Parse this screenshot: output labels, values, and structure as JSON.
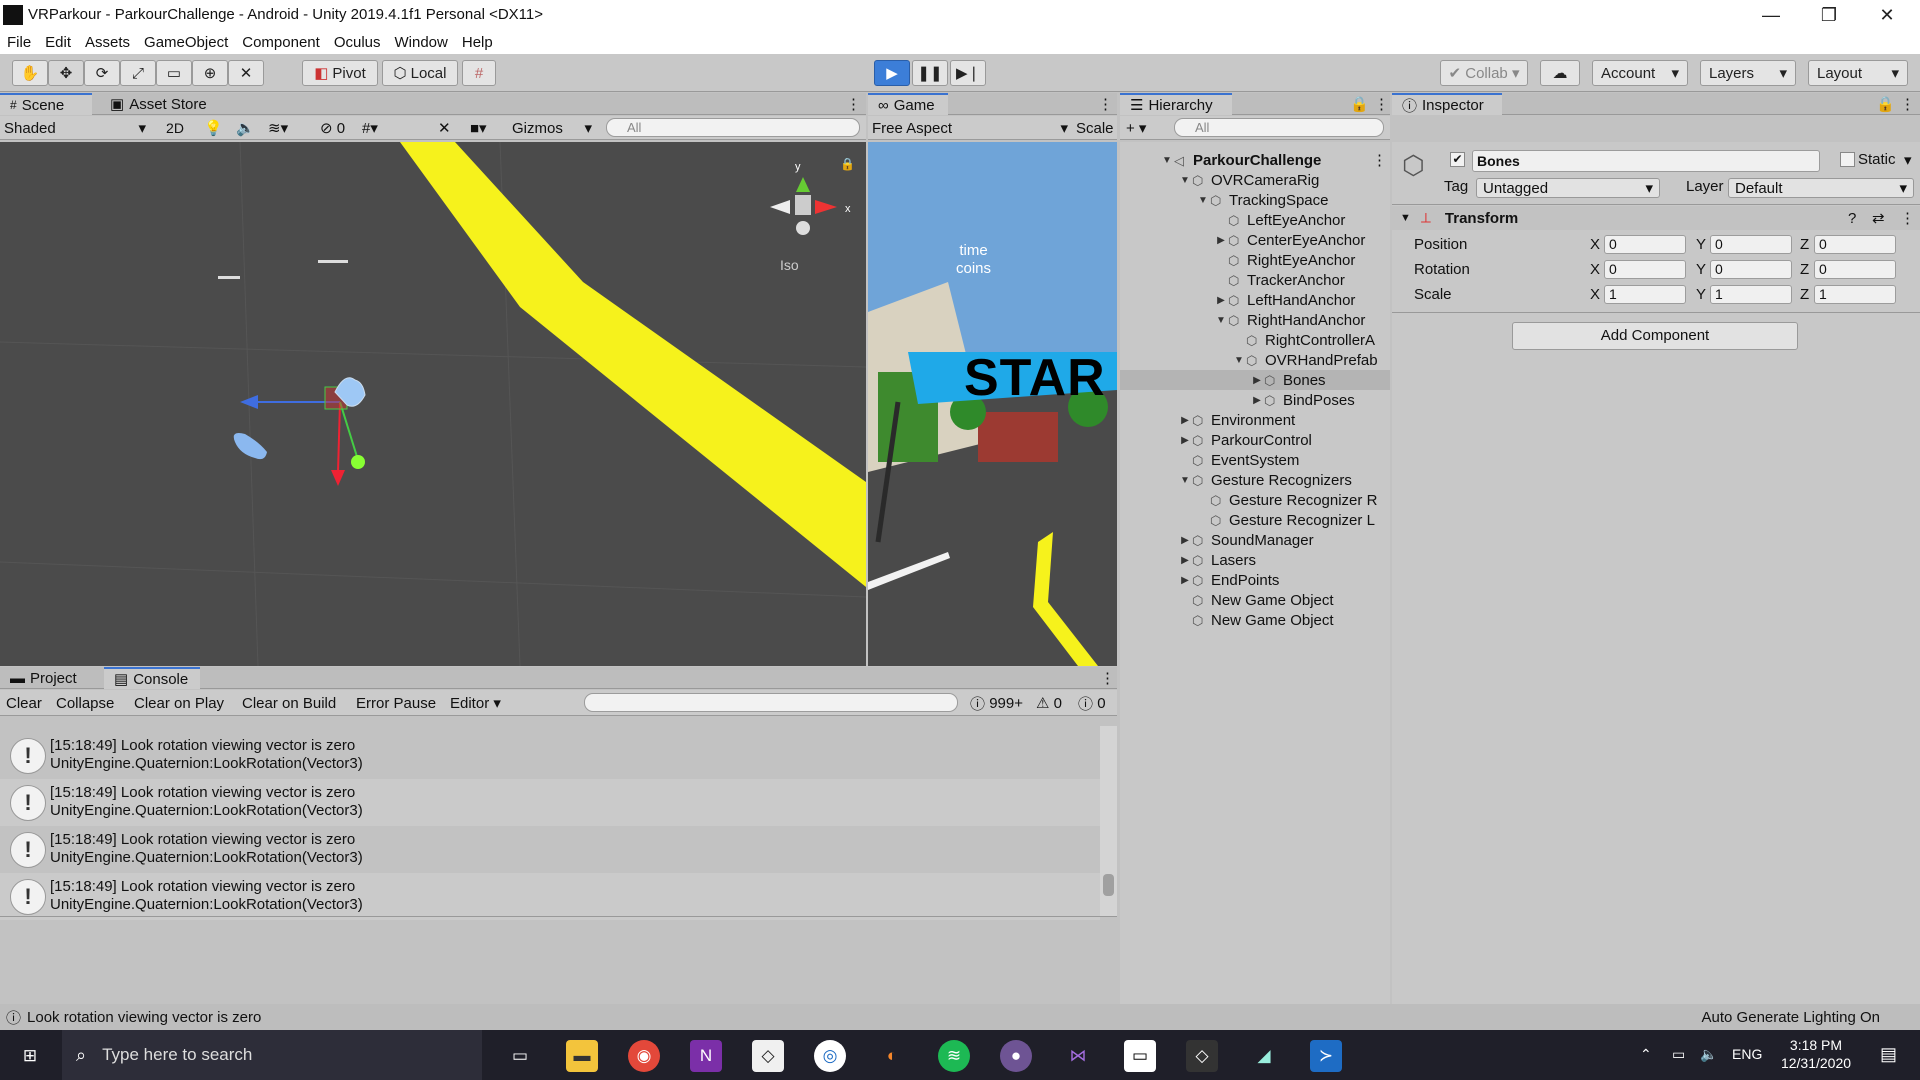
{
  "window": {
    "title": "VRParkour - ParkourChallenge - Android - Unity 2019.4.1f1 Personal <DX11>",
    "minimize": "—",
    "restore": "❐",
    "close": "✕"
  },
  "menu": [
    "File",
    "Edit",
    "Assets",
    "GameObject",
    "Component",
    "Oculus",
    "Window",
    "Help"
  ],
  "toolbar": {
    "pivot": "Pivot",
    "local": "Local",
    "collab": "Collab",
    "account": "Account",
    "layers": "Layers",
    "layout": "Layout"
  },
  "scene": {
    "tab_scene": "Scene",
    "tab_asset_store": "Asset Store",
    "shading": "Shaded",
    "mode_2d": "2D",
    "hidden_count": "0",
    "gizmos": "Gizmos",
    "search_placeholder": "All",
    "iso": "Iso",
    "gizmo_x": "x",
    "gizmo_y": "y"
  },
  "game": {
    "tab": "Game",
    "aspect": "Free Aspect",
    "scale": "Scale",
    "hud_time": "time",
    "hud_coins": "coins",
    "banner": "STAR"
  },
  "hierarchy": {
    "tab": "Hierarchy",
    "search_placeholder": "All",
    "add": "+",
    "items": [
      {
        "label": "ParkourChallenge",
        "depth": 0,
        "arrow": "▼",
        "bold": true
      },
      {
        "label": "OVRCameraRig",
        "depth": 1,
        "arrow": "▼"
      },
      {
        "label": "TrackingSpace",
        "depth": 2,
        "arrow": "▼"
      },
      {
        "label": "LeftEyeAnchor",
        "depth": 3,
        "arrow": ""
      },
      {
        "label": "CenterEyeAnchor",
        "depth": 3,
        "arrow": "▶"
      },
      {
        "label": "RightEyeAnchor",
        "depth": 3,
        "arrow": ""
      },
      {
        "label": "TrackerAnchor",
        "depth": 3,
        "arrow": ""
      },
      {
        "label": "LeftHandAnchor",
        "depth": 3,
        "arrow": "▶"
      },
      {
        "label": "RightHandAnchor",
        "depth": 3,
        "arrow": "▼"
      },
      {
        "label": "RightControllerA",
        "depth": 4,
        "arrow": ""
      },
      {
        "label": "OVRHandPrefab",
        "depth": 4,
        "arrow": "▼"
      },
      {
        "label": "Bones",
        "depth": 5,
        "arrow": "▶",
        "selected": true
      },
      {
        "label": "BindPoses",
        "depth": 5,
        "arrow": "▶"
      },
      {
        "label": "Environment",
        "depth": 1,
        "arrow": "▶"
      },
      {
        "label": "ParkourControl",
        "depth": 1,
        "arrow": "▶"
      },
      {
        "label": "EventSystem",
        "depth": 1,
        "arrow": ""
      },
      {
        "label": "Gesture Recognizers",
        "depth": 1,
        "arrow": "▼"
      },
      {
        "label": "Gesture Recognizer R",
        "depth": 2,
        "arrow": ""
      },
      {
        "label": "Gesture Recognizer L",
        "depth": 2,
        "arrow": ""
      },
      {
        "label": "SoundManager",
        "depth": 1,
        "arrow": "▶"
      },
      {
        "label": "Lasers",
        "depth": 1,
        "arrow": "▶"
      },
      {
        "label": "EndPoints",
        "depth": 1,
        "arrow": "▶"
      },
      {
        "label": "New Game Object",
        "depth": 1,
        "arrow": ""
      },
      {
        "label": "New Game Object",
        "depth": 1,
        "arrow": ""
      }
    ]
  },
  "inspector": {
    "tab": "Inspector",
    "name": "Bones",
    "static": "Static",
    "tag_label": "Tag",
    "tag": "Untagged",
    "layer_label": "Layer",
    "layer": "Default",
    "component": "Transform",
    "rows": [
      {
        "label": "Position",
        "x": "0",
        "y": "0",
        "z": "0"
      },
      {
        "label": "Rotation",
        "x": "0",
        "y": "0",
        "z": "0"
      },
      {
        "label": "Scale",
        "x": "1",
        "y": "1",
        "z": "1"
      }
    ],
    "axis_x": "X",
    "axis_y": "Y",
    "axis_z": "Z",
    "add_component": "Add Component"
  },
  "console": {
    "tab_project": "Project",
    "tab_console": "Console",
    "clear": "Clear",
    "collapse": "Collapse",
    "clear_on_play": "Clear on Play",
    "clear_on_build": "Clear on Build",
    "error_pause": "Error Pause",
    "editor": "Editor",
    "count_log": "999+",
    "count_warn": "0",
    "count_err": "0",
    "entries": [
      {
        "line1": "[15:18:49] Look rotation viewing vector is zero",
        "line2": "UnityEngine.Quaternion:LookRotation(Vector3)"
      },
      {
        "line1": "[15:18:49] Look rotation viewing vector is zero",
        "line2": "UnityEngine.Quaternion:LookRotation(Vector3)"
      },
      {
        "line1": "[15:18:49] Look rotation viewing vector is zero",
        "line2": "UnityEngine.Quaternion:LookRotation(Vector3)"
      },
      {
        "line1": "[15:18:49] Look rotation viewing vector is zero",
        "line2": "UnityEngine.Quaternion:LookRotation(Vector3)"
      }
    ]
  },
  "status": {
    "message": "Look rotation viewing vector is zero",
    "right": "Auto Generate Lighting On"
  },
  "taskbar": {
    "search_placeholder": "Type here to search",
    "lang": "ENG",
    "time": "3:18 PM",
    "date": "12/31/2020"
  },
  "colors": {
    "accent": "#3a72d0",
    "yellow_path": "#f6f21c",
    "banner": "#1fa9e8"
  }
}
